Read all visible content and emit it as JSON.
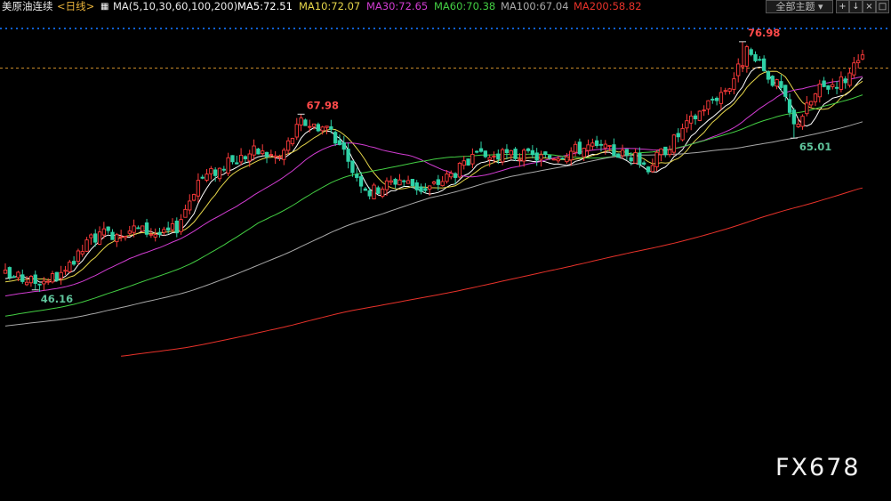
{
  "header": {
    "symbol": "美原油连续",
    "period": "<日线>",
    "ma_params": "MA(5,10,30,60,100,200)",
    "ma_values": [
      {
        "label": "MA5:72.51",
        "color": "#ffffff"
      },
      {
        "label": "MA10:72.07",
        "color": "#e6d64a"
      },
      {
        "label": "MA30:72.65",
        "color": "#d23cd2"
      },
      {
        "label": "MA60:70.38",
        "color": "#43cf43"
      },
      {
        "label": "MA100:67.04",
        "color": "#a8a8a8"
      },
      {
        "label": "MA200:58.82",
        "color": "#e8322a"
      }
    ],
    "theme_button": "全部主题",
    "tools": [
      "+",
      "↓",
      "×",
      "□"
    ]
  },
  "watermark": "FX678",
  "chart_data": {
    "type": "candlestick",
    "ylim": [
      45,
      80.5
    ],
    "reference_price": 73.7,
    "annotations": [
      {
        "label": "46.16",
        "value": 46.16,
        "kind": "low",
        "color": "#5fc39b",
        "candle_index": 7
      },
      {
        "label": "67.98",
        "value": 67.98,
        "kind": "high",
        "color": "#ff4a4a",
        "candle_index": 69
      },
      {
        "label": "76.98",
        "value": 76.98,
        "kind": "high",
        "color": "#ff4a4a",
        "candle_index": 172
      },
      {
        "label": "65.01",
        "value": 65.01,
        "kind": "low",
        "color": "#5fc39b",
        "candle_index": 184
      }
    ],
    "price_anchors": [
      [
        0,
        48
      ],
      [
        7,
        47.2
      ],
      [
        14,
        48.1
      ],
      [
        20,
        52.6
      ],
      [
        30,
        53.8
      ],
      [
        37,
        53
      ],
      [
        40,
        54
      ],
      [
        45,
        59.8
      ],
      [
        52,
        61.8
      ],
      [
        58,
        63.4
      ],
      [
        64,
        62.6
      ],
      [
        69,
        67
      ],
      [
        76,
        66.2
      ],
      [
        80,
        61.8
      ],
      [
        85,
        58.3
      ],
      [
        92,
        60
      ],
      [
        98,
        58.5
      ],
      [
        104,
        60.5
      ],
      [
        110,
        62.6
      ],
      [
        118,
        62.9
      ],
      [
        126,
        62.6
      ],
      [
        136,
        64
      ],
      [
        146,
        62.8
      ],
      [
        150,
        61.5
      ],
      [
        156,
        64.8
      ],
      [
        163,
        68.9
      ],
      [
        169,
        71.6
      ],
      [
        173,
        75.6
      ],
      [
        177,
        73.4
      ],
      [
        181,
        71
      ],
      [
        184,
        66.5
      ],
      [
        190,
        71.1
      ],
      [
        196,
        72.4
      ],
      [
        200,
        74.8
      ]
    ],
    "moving_averages": [
      {
        "period": 5,
        "color": "#ffffff",
        "start": [
          0,
          47.3
        ],
        "end_value": 72.51
      },
      {
        "period": 10,
        "color": "#e6d64a",
        "start": [
          0,
          47
        ],
        "end_value": 72.07
      },
      {
        "period": 30,
        "color": "#d23cd2",
        "start": [
          0,
          45.3
        ],
        "end_value": 72.65
      },
      {
        "period": 60,
        "color": "#43cf43",
        "start": [
          0,
          42.8
        ],
        "end_value": 70.38
      },
      {
        "period": 100,
        "color": "#a8a8a8",
        "start": [
          0,
          41.6
        ],
        "end_value": 67.04
      },
      {
        "period": 200,
        "color": "#e8322a",
        "start": [
          27,
          36
        ],
        "end_value": 58.82
      }
    ],
    "colors": {
      "up": "#ff3b3b",
      "down": "#2fd1a6",
      "ref_line": "#c98a2a",
      "grid": "#0f5fd0"
    }
  }
}
